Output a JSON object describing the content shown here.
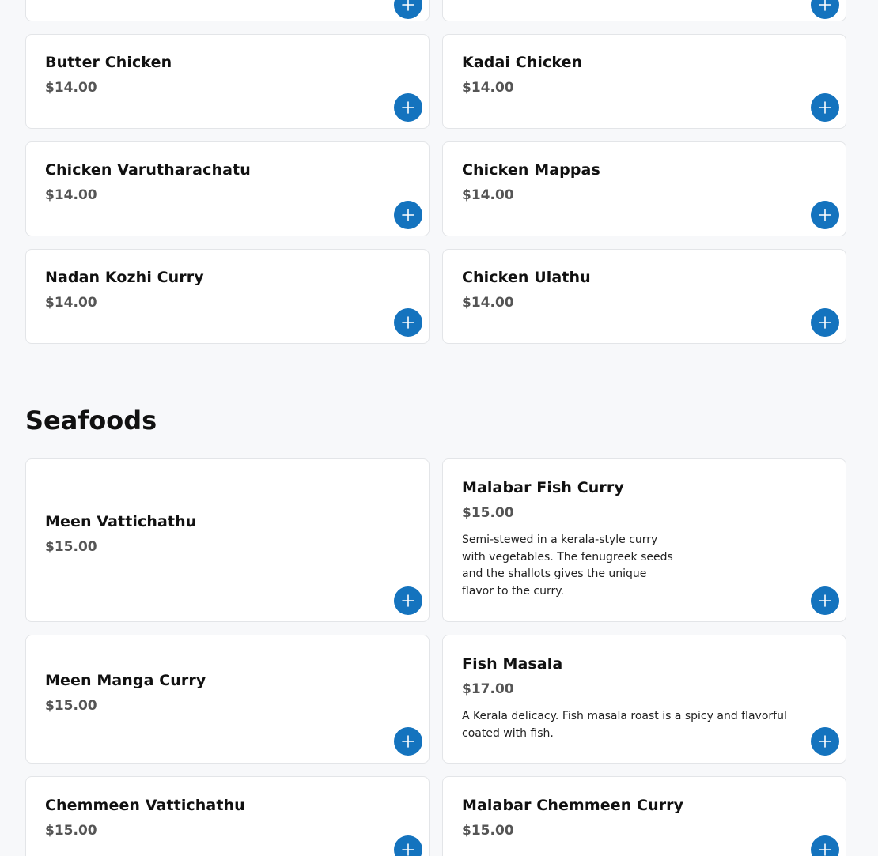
{
  "chicken": {
    "items": [
      {
        "name": "",
        "price": ""
      },
      {
        "name": "",
        "price": ""
      },
      {
        "name": "Butter Chicken",
        "price": "$14.00"
      },
      {
        "name": "Kadai Chicken",
        "price": "$14.00"
      },
      {
        "name": "Chicken Varutharachatu",
        "price": "$14.00"
      },
      {
        "name": "Chicken Mappas",
        "price": "$14.00"
      },
      {
        "name": "Nadan Kozhi Curry",
        "price": "$14.00"
      },
      {
        "name": "Chicken Ulathu",
        "price": "$14.00"
      }
    ]
  },
  "seafoods": {
    "title": "Seafoods",
    "items": [
      {
        "name": "Meen Vattichathu",
        "price": "$15.00",
        "description": ""
      },
      {
        "name": "Malabar Fish Curry",
        "price": "$15.00",
        "description": "Semi-stewed in a kerala-style curry with vegetables. The fenugreek seeds and the shallots gives the unique flavor to the curry."
      },
      {
        "name": "Meen Manga Curry",
        "price": "$15.00",
        "description": ""
      },
      {
        "name": "Fish Masala",
        "price": "$17.00",
        "description": "A Kerala delicacy. Fish masala roast is a spicy and flavorful coated with fish."
      },
      {
        "name": "Chemmeen Vattichathu",
        "price": "$15.00",
        "description": ""
      },
      {
        "name": "Malabar Chemmeen Curry",
        "price": "$15.00",
        "description": ""
      }
    ]
  },
  "add_button_icon": "plus-icon",
  "colors": {
    "accent": "#1473be",
    "background": "#f7f8fa",
    "card": "#ffffff",
    "price": "#555555"
  }
}
